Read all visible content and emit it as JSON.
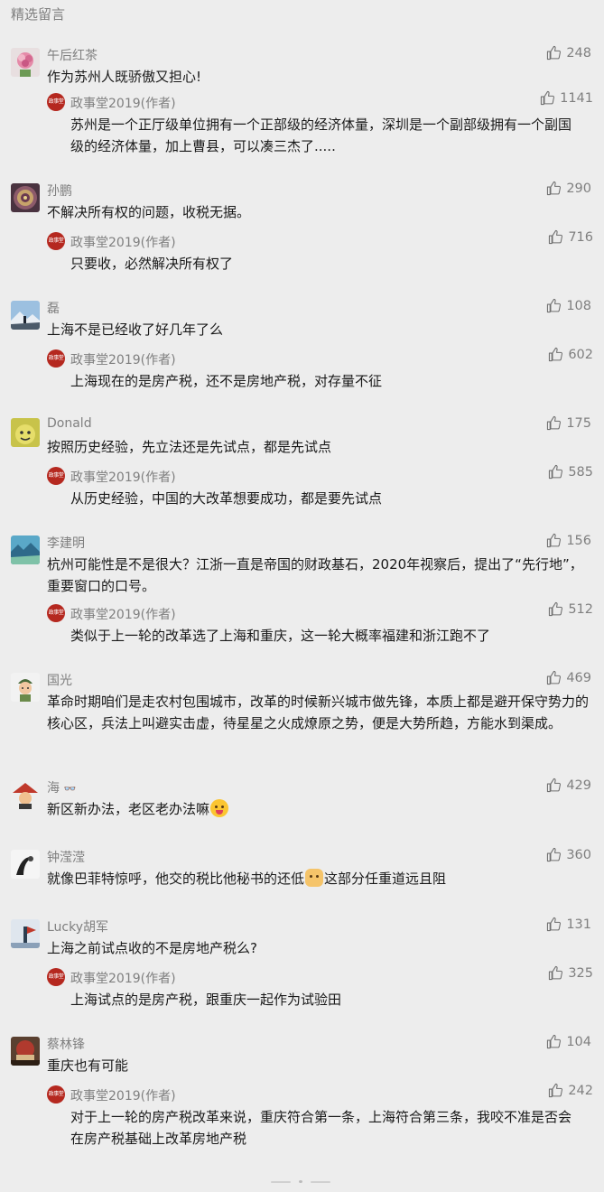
{
  "section_title": "精选留言",
  "author_badge_text": "政事堂",
  "comments": [
    {
      "name": "午后红茶",
      "text": "作为苏州人既骄傲又担心!",
      "likes": "248",
      "reply": {
        "name": "政事堂2019(作者)",
        "text": "苏州是一个正厅级单位拥有一个正部级的经济体量，深圳是一个副部级拥有一个副国级的经济体量，加上曹县，可以凑三杰了.....",
        "likes": "1141"
      }
    },
    {
      "name": "孙鹏",
      "text": "不解决所有权的问题，收税无据。",
      "likes": "290",
      "reply": {
        "name": "政事堂2019(作者)",
        "text": "只要收，必然解决所有权了",
        "likes": "716"
      }
    },
    {
      "name": "磊",
      "text": "上海不是已经收了好几年了么",
      "likes": "108",
      "reply": {
        "name": "政事堂2019(作者)",
        "text": "上海现在的是房产税，还不是房地产税，对存量不征",
        "likes": "602"
      }
    },
    {
      "name": "Donald",
      "text": "按照历史经验，先立法还是先试点，都是先试点",
      "likes": "175",
      "reply": {
        "name": "政事堂2019(作者)",
        "text": "从历史经验，中国的大改革想要成功，都是要先试点",
        "likes": "585"
      }
    },
    {
      "name": "李建明",
      "text": "杭州可能性是不是很大？江浙一直是帝国的财政基石，2020年视察后，提出了“先行地”，重要窗口的口号。",
      "likes": "156",
      "reply": {
        "name": "政事堂2019(作者)",
        "text": "类似于上一轮的改革选了上海和重庆，这一轮大概率福建和浙江跑不了",
        "likes": "512"
      }
    },
    {
      "name": "国光",
      "text": "革命时期咱们是走农村包围城市，改革的时候新兴城市做先锋，本质上都是避开保守势力的核心区，兵法上叫避实击虚，待星星之火成燎原之势，便是大势所趋，方能水到渠成。",
      "likes": "469",
      "reply": null
    },
    {
      "name": "海",
      "name_suffix": "👓",
      "text_before": "新区新办法，老区老办法嘛",
      "emoji": "tongue",
      "text_after": "",
      "likes": "429",
      "reply": null
    },
    {
      "name": "钟滢滢",
      "text_before": "就像巴菲特惊呼，他交的税比他秘书的还低",
      "emoji": "cat",
      "text_after": "这部分任重道远且阻",
      "likes": "360",
      "reply": null
    },
    {
      "name": "Lucky胡军",
      "text": "上海之前试点收的不是房地产税么?",
      "likes": "131",
      "reply": {
        "name": "政事堂2019(作者)",
        "text": "上海试点的是房产税，跟重庆一起作为试验田",
        "likes": "325"
      }
    },
    {
      "name": "蔡林锋",
      "text": "重庆也有可能",
      "likes": "104",
      "reply": {
        "name": "政事堂2019(作者)",
        "text": "对于上一轮的房产税改革来说，重庆符合第一条，上海符合第三条，我咬不准是否会在房产税基础上改革房地产税",
        "likes": "242"
      }
    }
  ],
  "colors": {
    "background": "#ededed",
    "meta": "#7f7f7f",
    "text": "#191919",
    "badge": "#b5281f"
  }
}
